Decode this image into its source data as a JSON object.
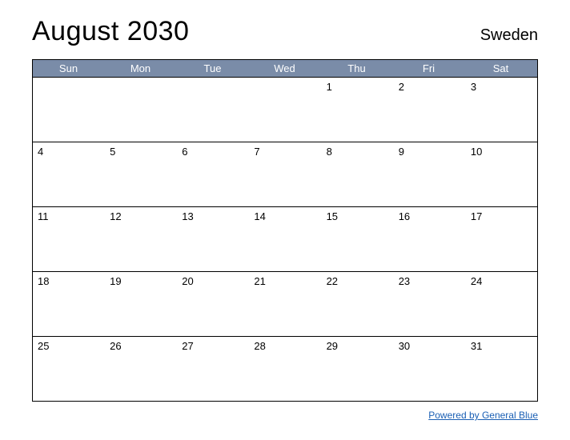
{
  "header": {
    "title": "August 2030",
    "country": "Sweden"
  },
  "dayheaders": [
    "Sun",
    "Mon",
    "Tue",
    "Wed",
    "Thu",
    "Fri",
    "Sat"
  ],
  "weeks": [
    [
      "",
      "",
      "",
      "",
      "1",
      "2",
      "3"
    ],
    [
      "4",
      "5",
      "6",
      "7",
      "8",
      "9",
      "10"
    ],
    [
      "11",
      "12",
      "13",
      "14",
      "15",
      "16",
      "17"
    ],
    [
      "18",
      "19",
      "20",
      "21",
      "22",
      "23",
      "24"
    ],
    [
      "25",
      "26",
      "27",
      "28",
      "29",
      "30",
      "31"
    ]
  ],
  "footer": {
    "link_text": "Powered by General Blue"
  }
}
